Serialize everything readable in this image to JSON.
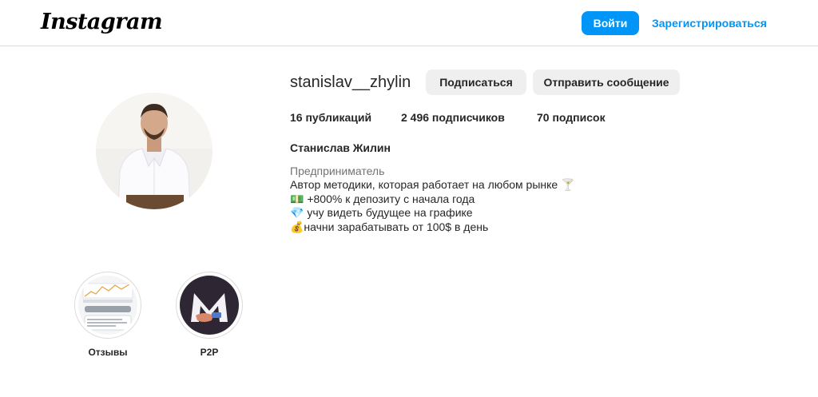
{
  "header": {
    "logo_text": "Instagram",
    "login_label": "Войти",
    "signup_label": "Зарегистрироваться"
  },
  "profile": {
    "username": "stanislav__zhylin",
    "follow_label": "Подписаться",
    "message_label": "Отправить сообщение",
    "posts_stat": "16 публикаций",
    "followers_stat": "2 496 подписчиков",
    "following_stat": "70 подписок",
    "full_name": "Станислав Жилин",
    "category": "Предприниматель",
    "bio_lines": [
      "Автор методики, которая работает на любом рынке 🍸",
      "💵 +800% к депозиту с начала года",
      "💎 учу видеть будущее на графике",
      "💰начни зарабатывать от 100$ в день"
    ]
  },
  "highlights": [
    {
      "label": "Отзывы"
    },
    {
      "label": "P2P"
    }
  ],
  "colors": {
    "accent": "#0095f6",
    "secondary_button": "#efefef",
    "divider": "#dbdbdb",
    "muted_text": "#737373"
  }
}
